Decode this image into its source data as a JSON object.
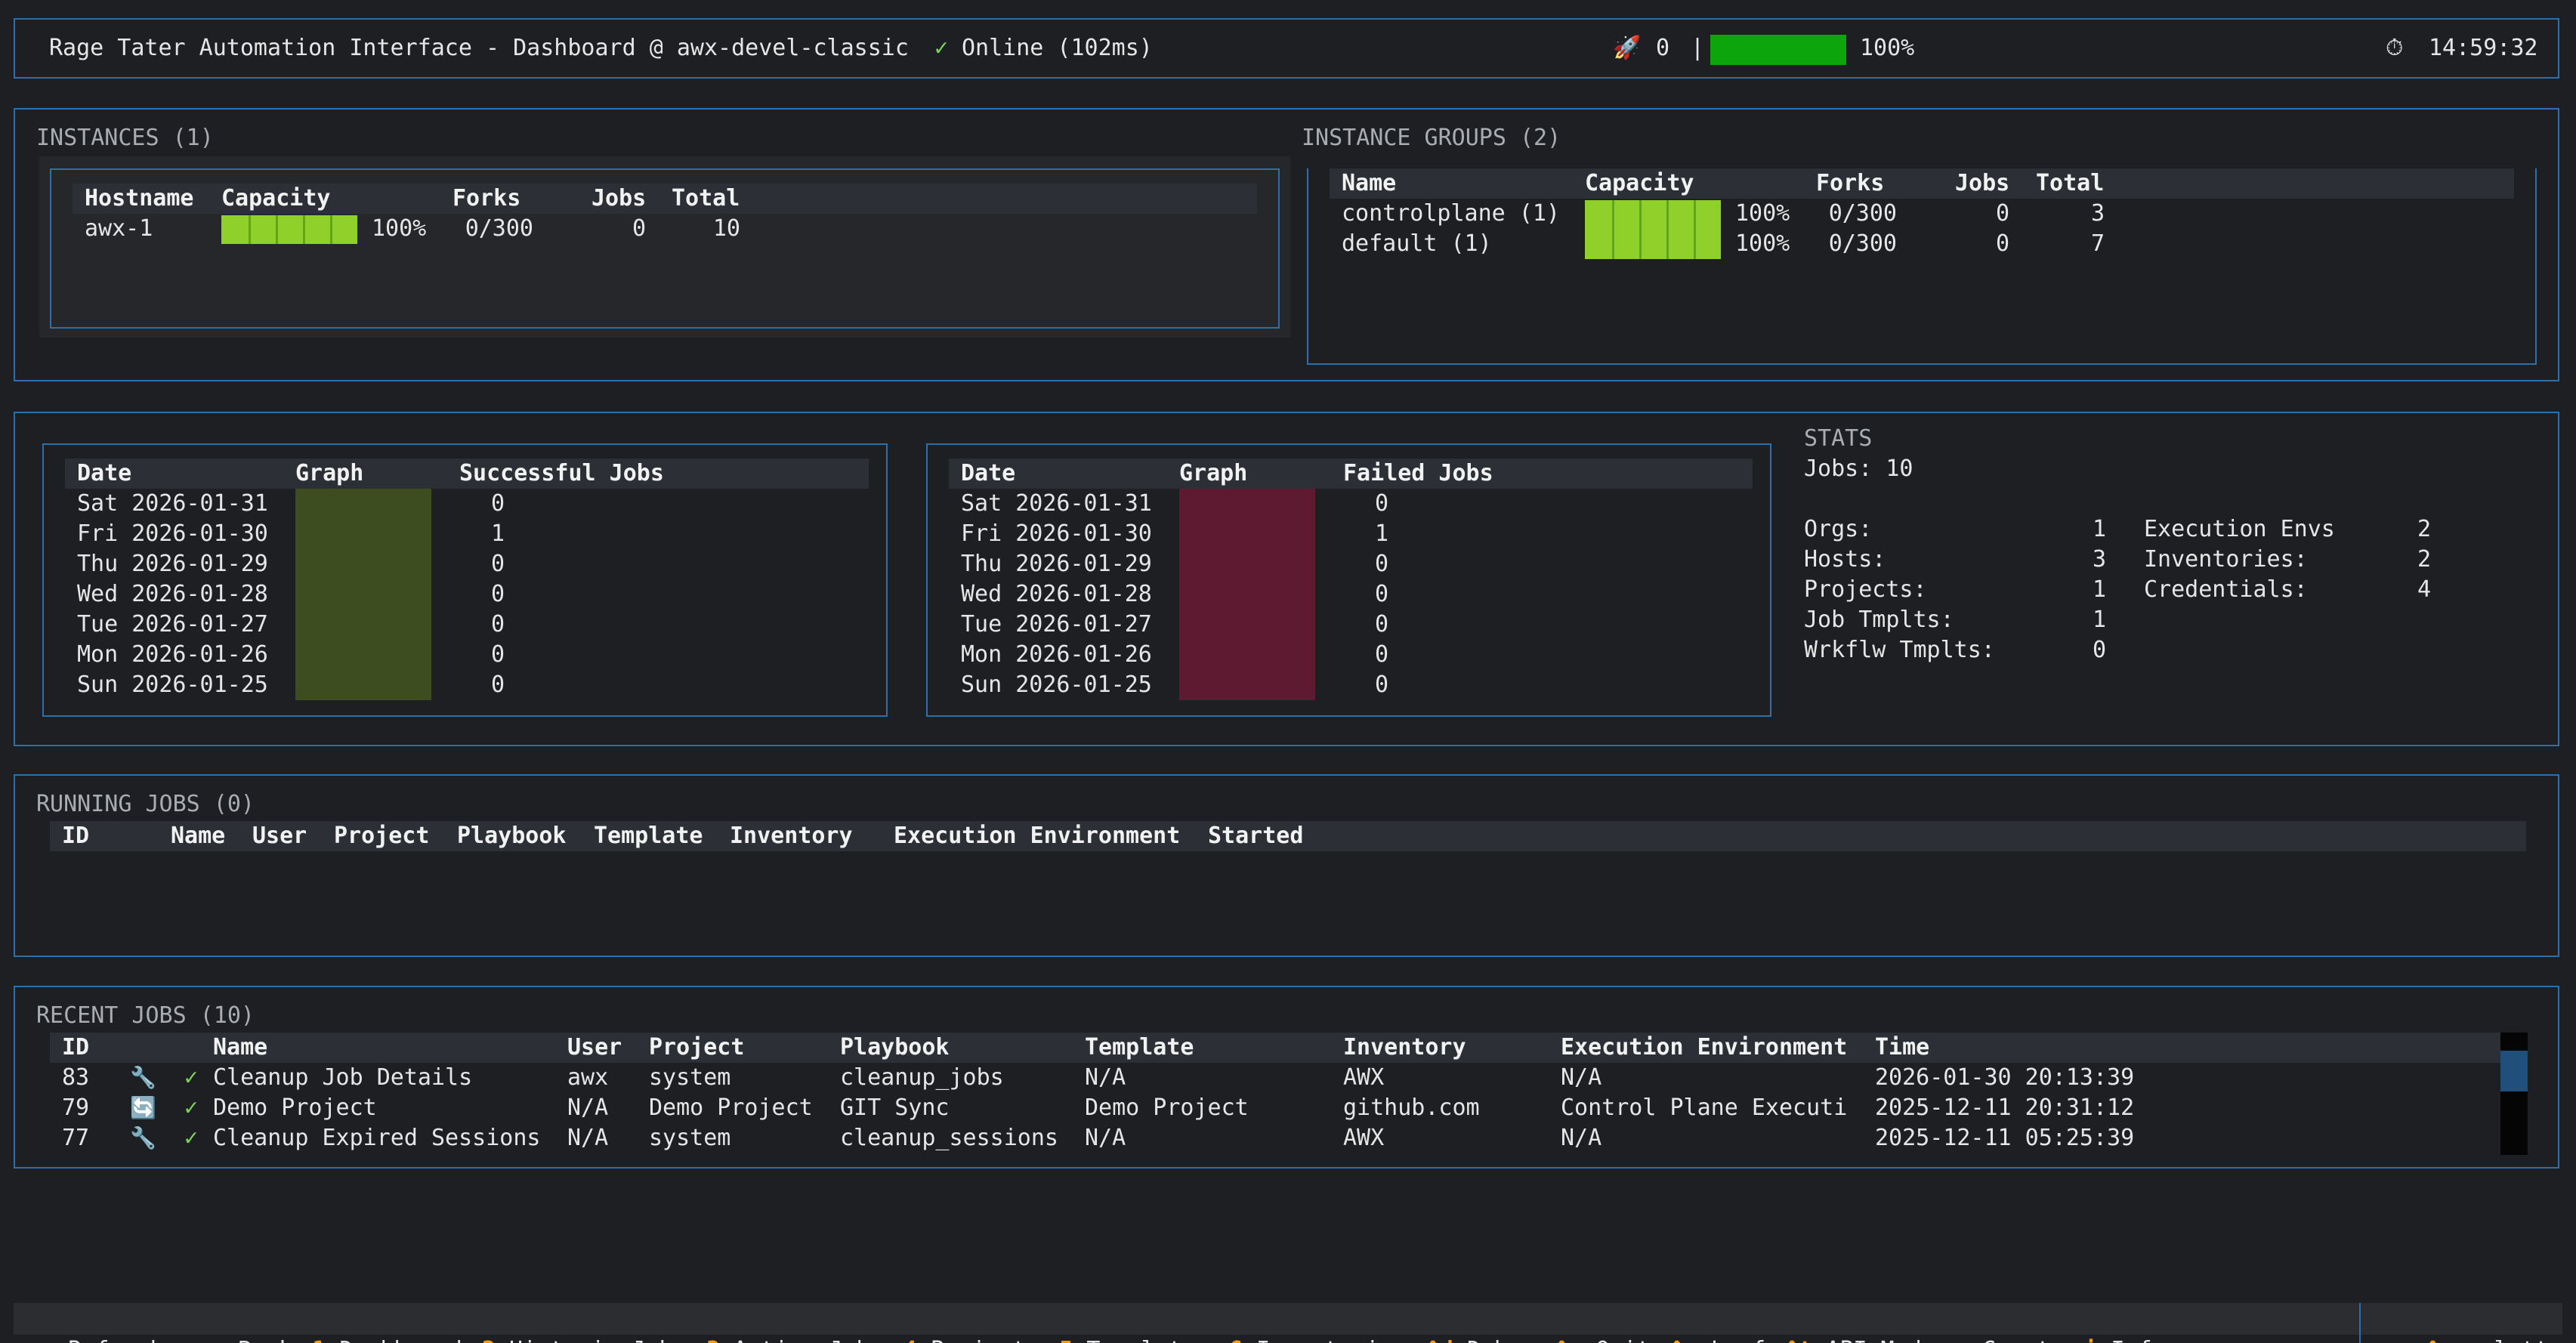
{
  "header": {
    "title": "Rage Tater Automation Interface - Dashboard @ awx-devel-classic",
    "check": "✓",
    "status": "Online (102ms)",
    "rocket_icon": "rocket-icon",
    "count": "0",
    "separator": "|",
    "progress_percent": "100%",
    "progress_value": 1.0,
    "clock_icon": "stopwatch-icon",
    "time": "14:59:32"
  },
  "instances": {
    "title": "INSTANCES (1)",
    "columns": [
      "Hostname",
      "Capacity",
      "Forks",
      "Jobs",
      "Total"
    ],
    "rows": [
      {
        "hostname": "awx-1",
        "capacity_pct": "100%",
        "capacity_value": 1.0,
        "forks": "0/300",
        "jobs": "0",
        "total": "10"
      }
    ]
  },
  "instance_groups": {
    "title": "INSTANCE GROUPS (2)",
    "columns": [
      "Name",
      "Capacity",
      "Forks",
      "Jobs",
      "Total"
    ],
    "rows": [
      {
        "name": "controlplane (1)",
        "capacity_pct": "100%",
        "capacity_value": 1.0,
        "forks": "0/300",
        "jobs": "0",
        "total": "3"
      },
      {
        "name": "default (1)",
        "capacity_pct": "100%",
        "capacity_value": 1.0,
        "forks": "0/300",
        "jobs": "0",
        "total": "7"
      }
    ]
  },
  "successful_jobs": {
    "columns": [
      "Date",
      "Graph",
      "Successful Jobs"
    ],
    "rows": [
      {
        "date": "Sat 2026-01-31",
        "value": "0"
      },
      {
        "date": "Fri 2026-01-30",
        "value": "1"
      },
      {
        "date": "Thu 2026-01-29",
        "value": "0"
      },
      {
        "date": "Wed 2026-01-28",
        "value": "0"
      },
      {
        "date": "Tue 2026-01-27",
        "value": "0"
      },
      {
        "date": "Mon 2026-01-26",
        "value": "0"
      },
      {
        "date": "Sun 2026-01-25",
        "value": "0"
      }
    ]
  },
  "failed_jobs": {
    "columns": [
      "Date",
      "Graph",
      "Failed Jobs"
    ],
    "rows": [
      {
        "date": "Sat 2026-01-31",
        "value": "0"
      },
      {
        "date": "Fri 2026-01-30",
        "value": "1"
      },
      {
        "date": "Thu 2026-01-29",
        "value": "0"
      },
      {
        "date": "Wed 2026-01-28",
        "value": "0"
      },
      {
        "date": "Tue 2026-01-27",
        "value": "0"
      },
      {
        "date": "Mon 2026-01-26",
        "value": "0"
      },
      {
        "date": "Sun 2026-01-25",
        "value": "0"
      }
    ]
  },
  "stats": {
    "title": "STATS",
    "jobs": "Jobs: 10",
    "left": [
      {
        "label": "Orgs:",
        "value": "1"
      },
      {
        "label": "Hosts:",
        "value": "3"
      },
      {
        "label": "Projects:",
        "value": "1"
      },
      {
        "label": "Job Tmplts:",
        "value": "1"
      },
      {
        "label": "Wrkflw Tmplts:",
        "value": "0"
      }
    ],
    "right": [
      {
        "label": "Execution Envs",
        "value": "2"
      },
      {
        "label": "Inventories:",
        "value": "2"
      },
      {
        "label": "Credentials:",
        "value": "4"
      }
    ]
  },
  "running_jobs": {
    "title": "RUNNING JOBS (0)",
    "columns": [
      "ID",
      "Name",
      "User",
      "Project",
      "Playbook",
      "Template",
      "Inventory",
      "Execution Environment",
      "Started"
    ]
  },
  "recent_jobs": {
    "title": "RECENT JOBS (10)",
    "columns": [
      "ID",
      "Name",
      "User",
      "Project",
      "Playbook",
      "Template",
      "Inventory",
      "Execution Environment",
      "Time"
    ],
    "rows": [
      {
        "id": "83",
        "type_icon": "wrench-icon",
        "type_glyph": "🔧",
        "status": "✓",
        "name": "Cleanup Job Details",
        "user": "awx",
        "project": "system",
        "playbook": "cleanup_jobs",
        "template": "N/A",
        "inventory": "AWX",
        "ee": "N/A",
        "time": "2026-01-30 20:13:39"
      },
      {
        "id": "79",
        "type_icon": "sync-icon",
        "type_glyph": "🔄",
        "status": "✓",
        "name": "Demo Project",
        "user": "N/A",
        "project": "Demo Project",
        "playbook": "GIT Sync",
        "template": "Demo Project",
        "inventory": "github.com",
        "ee": "Control Plane Executi",
        "time": "2025-12-11 20:31:12"
      },
      {
        "id": "77",
        "type_icon": "wrench-icon",
        "type_glyph": "🔧",
        "status": "✓",
        "name": "Cleanup Expired Sessions",
        "user": "N/A",
        "project": "system",
        "playbook": "cleanup_sessions",
        "template": "N/A",
        "inventory": "AWX",
        "ee": "N/A",
        "time": "2025-12-11 05:25:39"
      }
    ]
  },
  "footer": {
    "items": [
      {
        "key": "r",
        "label": "Refresh"
      },
      {
        "key": "esc",
        "label": "Back"
      },
      {
        "key": "1",
        "label": "Dashboard"
      },
      {
        "key": "2",
        "label": "Historic Jobs"
      },
      {
        "key": "3",
        "label": "Active Jobs"
      },
      {
        "key": "4",
        "label": "Projects"
      },
      {
        "key": "5",
        "label": "Templates"
      },
      {
        "key": "6",
        "label": "Inventories"
      },
      {
        "key": "^d",
        "label": "Debug"
      },
      {
        "key": "^q",
        "label": "Quit"
      },
      {
        "key": "^o",
        "label": "Loaf"
      },
      {
        "key": "^t",
        "label": "API Mode"
      },
      {
        "key": "c",
        "label": "Create"
      },
      {
        "key": "i",
        "label": "Info"
      }
    ],
    "palette": {
      "key": "^p",
      "label": "palette"
    }
  },
  "colors": {
    "accent_border": "#2d6fa8",
    "capacity_bar": "#8fd12a",
    "success_graph": "#3d4d20",
    "failed_graph": "#5e1a31",
    "key_color": "#f39c12"
  }
}
